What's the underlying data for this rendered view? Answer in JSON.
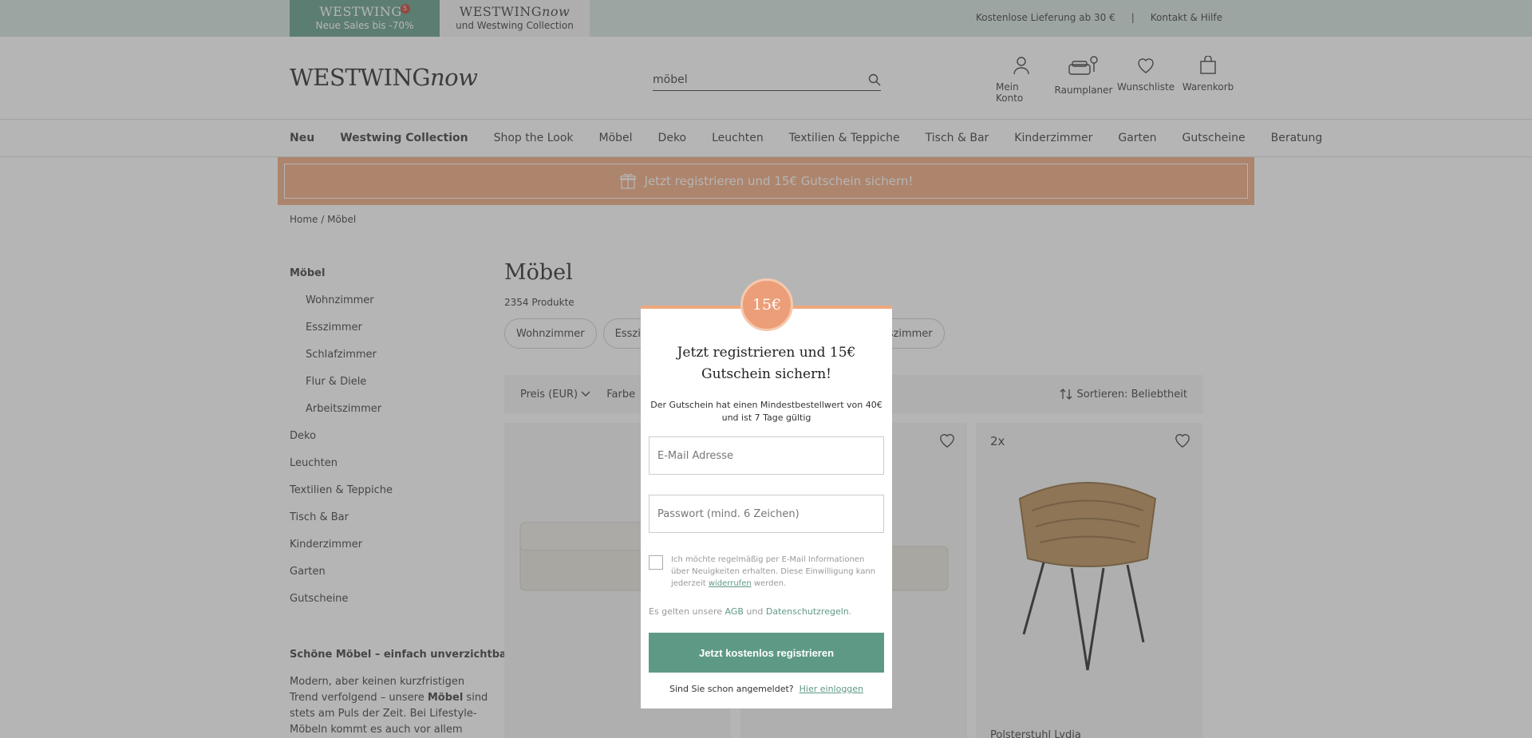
{
  "topbar": {
    "tab1_brand": "WESTWING",
    "tab1_badge": "5",
    "tab1_sub": "Neue Sales bis -70%",
    "tab2_brand_a": "WESTWING",
    "tab2_brand_b": "now",
    "tab2_sub": "und Westwing Collection",
    "delivery": "Kostenlose Lieferung ab 30 €",
    "separator": "|",
    "contact": "Kontakt & Hilfe"
  },
  "header": {
    "logo_a": "WESTWING",
    "logo_b": "now",
    "search_value": "möbel",
    "icons": [
      {
        "label": "Mein Konto",
        "icon": "user-icon"
      },
      {
        "label": "Raumplaner",
        "icon": "room-planner-icon"
      },
      {
        "label": "Wunschliste",
        "icon": "heart-icon"
      },
      {
        "label": "Warenkorb",
        "icon": "bag-icon"
      }
    ]
  },
  "nav": [
    "Neu",
    "Westwing Collection",
    "Shop the Look",
    "Möbel",
    "Deko",
    "Leuchten",
    "Textilien & Teppiche",
    "Tisch & Bar",
    "Kinderzimmer",
    "Garten",
    "Gutscheine",
    "Beratung"
  ],
  "promo": {
    "text": "Jetzt registrieren und 15€ Gutschein sichern!",
    "icon": "gift-icon"
  },
  "breadcrumb": {
    "home": "Home",
    "sep": "/",
    "current": "Möbel"
  },
  "sidebar": {
    "items": [
      {
        "label": "Möbel",
        "type": "head"
      },
      {
        "label": "Wohnzimmer",
        "type": "sub"
      },
      {
        "label": "Esszimmer",
        "type": "sub"
      },
      {
        "label": "Schlafzimmer",
        "type": "sub"
      },
      {
        "label": "Flur & Diele",
        "type": "sub"
      },
      {
        "label": "Arbeitszimmer",
        "type": "sub"
      },
      {
        "label": "Deko",
        "type": "top"
      },
      {
        "label": "Leuchten",
        "type": "top"
      },
      {
        "label": "Textilien & Teppiche",
        "type": "top"
      },
      {
        "label": "Tisch & Bar",
        "type": "top"
      },
      {
        "label": "Kinderzimmer",
        "type": "top"
      },
      {
        "label": "Garten",
        "type": "top"
      },
      {
        "label": "Gutscheine",
        "type": "top"
      }
    ],
    "seo_title": "Schöne Möbel – einfach unverzichtbar",
    "seo_text_a": "Modern, aber keinen kurzfristigen Trend verfolgend – unsere ",
    "seo_text_bold": "Möbel",
    "seo_text_b": " sind stets am Puls der Zeit. Bei Lifestyle-Möbeln kommt es auch vor allem"
  },
  "main": {
    "title": "Möbel",
    "count": "2354 Produkte",
    "chips": [
      "Wohnzimmer",
      "Esszim",
      "rbeitszimmer"
    ],
    "filters": {
      "price": "Preis (EUR)",
      "color": "Farbe",
      "sort": "Sortieren: Beliebtheit"
    },
    "card3_multi": "2x",
    "card3_title": "Polsterstuhl Lydia"
  },
  "modal": {
    "coin": "15€",
    "title": "Jetzt registrieren und 15€ Gutschein sichern!",
    "desc": "Der Gutschein hat einen Mindestbestellwert von 40€ und ist 7 Tage gültig",
    "email_placeholder": "E-Mail Adresse",
    "password_placeholder": "Passwort (mind. 6 Zeichen)",
    "checkbox_text_a": "Ich möchte regelmäßig per E-Mail Informationen über Neuigkeiten erhalten. Diese Einwilligung kann jederzeit ",
    "checkbox_link": "widerrufen",
    "checkbox_text_b": " werden.",
    "terms_a": "Es gelten unsere ",
    "terms_agb": "AGB",
    "terms_and": " und ",
    "terms_privacy": "Datenschutzregeln",
    "terms_end": ".",
    "register_button": "Jetzt kostenlos registrieren",
    "login_prompt": "Sind Sie schon angemeldet?",
    "login_link": "Hier einloggen"
  },
  "colors": {
    "accent": "#5e9986",
    "promo": "#f0a77a",
    "topbar": "#d4e2df"
  }
}
